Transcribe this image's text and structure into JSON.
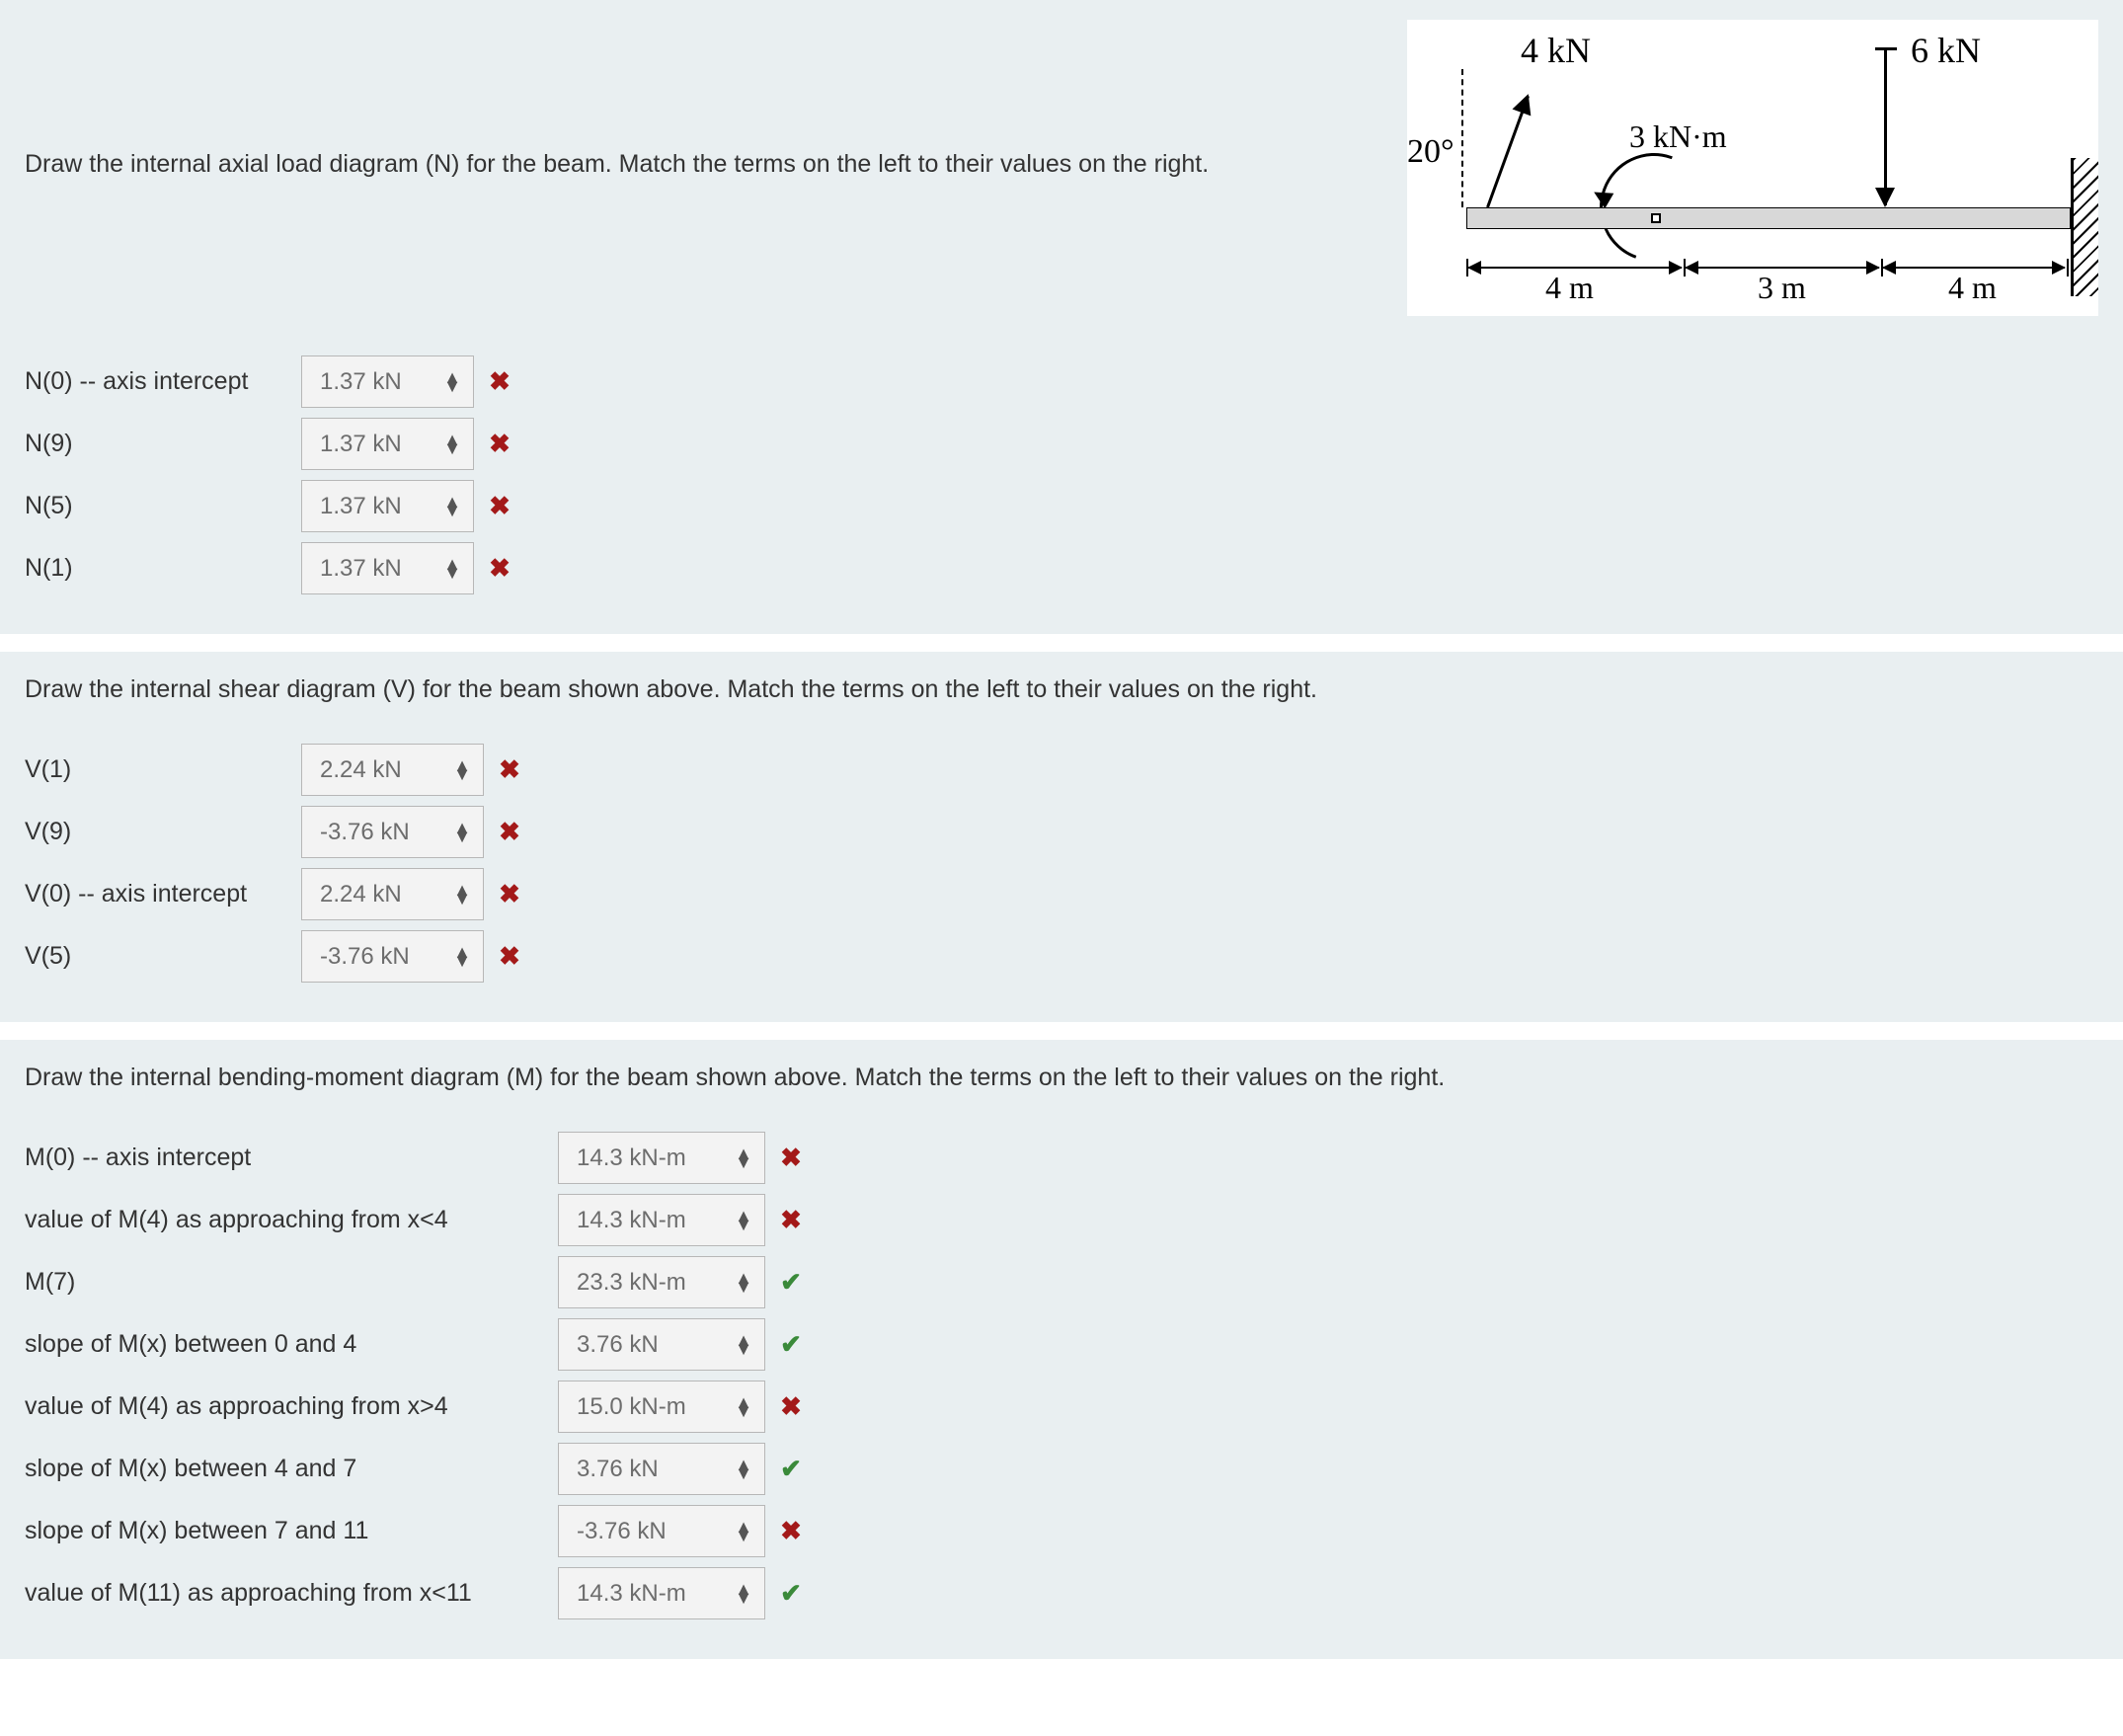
{
  "beam": {
    "force1": "4 kN",
    "force2": "6 kN",
    "moment": "3 kN·m",
    "angle": "20°",
    "span1": "4 m",
    "span2": "3 m",
    "span3": "4 m"
  },
  "sections": [
    {
      "prompt": "Draw the internal axial load diagram (N) for the beam. Match the terms on the left to their values on the right.",
      "labelWidth": "narrow",
      "selectWidth": 175,
      "showBeam": true,
      "rows": [
        {
          "label": "N(0) -- axis intercept",
          "value": "1.37 kN",
          "status": "wrong"
        },
        {
          "label": "N(9)",
          "value": "1.37 kN",
          "status": "wrong"
        },
        {
          "label": "N(5)",
          "value": "1.37 kN",
          "status": "wrong"
        },
        {
          "label": "N(1)",
          "value": "1.37 kN",
          "status": "wrong"
        }
      ]
    },
    {
      "prompt": "Draw the internal shear diagram (V) for the beam shown above. Match the terms on the left to their values on the right.",
      "labelWidth": "narrow",
      "selectWidth": 185,
      "showBeam": false,
      "rows": [
        {
          "label": "V(1)",
          "value": "2.24 kN",
          "status": "wrong"
        },
        {
          "label": "V(9)",
          "value": "-3.76 kN",
          "status": "wrong"
        },
        {
          "label": "V(0) -- axis intercept",
          "value": "2.24 kN",
          "status": "wrong"
        },
        {
          "label": "V(5)",
          "value": "-3.76 kN",
          "status": "wrong"
        }
      ]
    },
    {
      "prompt": "Draw the internal bending-moment diagram (M) for the beam shown above. Match the terms on the left to their values on the right.",
      "labelWidth": "wide",
      "selectWidth": 210,
      "showBeam": false,
      "rows": [
        {
          "label": "M(0) -- axis intercept",
          "value": "14.3 kN-m",
          "status": "wrong"
        },
        {
          "label": "value of M(4) as approaching from x<4",
          "value": "14.3 kN-m",
          "status": "wrong"
        },
        {
          "label": "M(7)",
          "value": "23.3 kN-m",
          "status": "correct"
        },
        {
          "label": "slope of M(x) between 0 and 4",
          "value": "3.76 kN",
          "status": "correct"
        },
        {
          "label": "value of M(4) as approaching from x>4",
          "value": "15.0 kN-m",
          "status": "wrong"
        },
        {
          "label": "slope of M(x) between 4 and 7",
          "value": "3.76 kN",
          "status": "correct"
        },
        {
          "label": "slope of M(x) between 7 and 11",
          "value": "-3.76 kN",
          "status": "wrong"
        },
        {
          "label": "value of M(11) as approaching from x<11",
          "value": "14.3 kN-m",
          "status": "correct"
        }
      ]
    }
  ]
}
